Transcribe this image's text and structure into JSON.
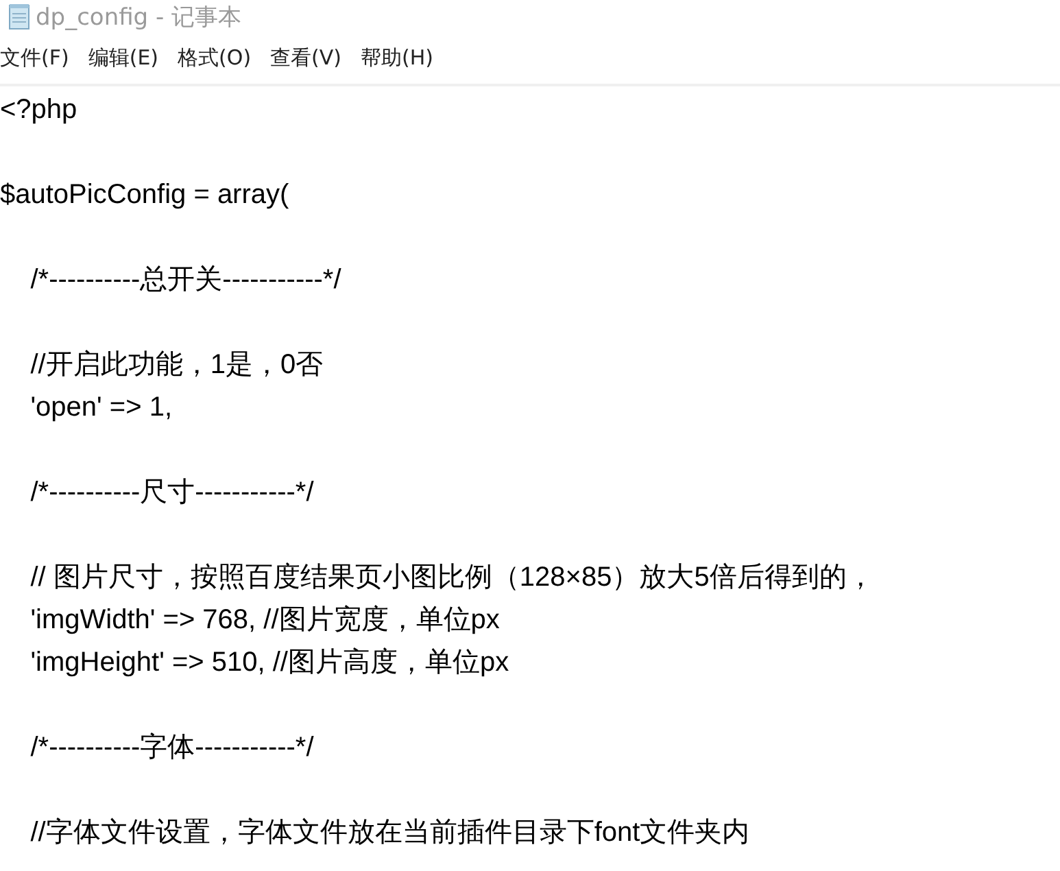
{
  "window": {
    "title": "dp_config - 记事本"
  },
  "menu": [
    {
      "label": "文件(F)"
    },
    {
      "label": "编辑(E)"
    },
    {
      "label": "格式(O)"
    },
    {
      "label": "查看(V)"
    },
    {
      "label": "帮助(H)"
    }
  ],
  "editor": {
    "blocks": [
      [
        "<?php"
      ],
      [
        "$autoPicConfig = array("
      ],
      [
        "    /*----------总开关-----------*/"
      ],
      [
        "    //开启此功能，1是，0否",
        "    'open' => 1,"
      ],
      [
        "    /*----------尺寸-----------*/"
      ],
      [
        "    // 图片尺寸，按照百度结果页小图比例（128×85）放大5倍后得到的，",
        "    'imgWidth' => 768, //图片宽度，单位px",
        "    'imgHeight' => 510, //图片高度，单位px"
      ],
      [
        "    /*----------字体-----------*/"
      ],
      [
        "    //字体文件设置，字体文件放在当前插件目录下font文件夹内"
      ]
    ]
  }
}
